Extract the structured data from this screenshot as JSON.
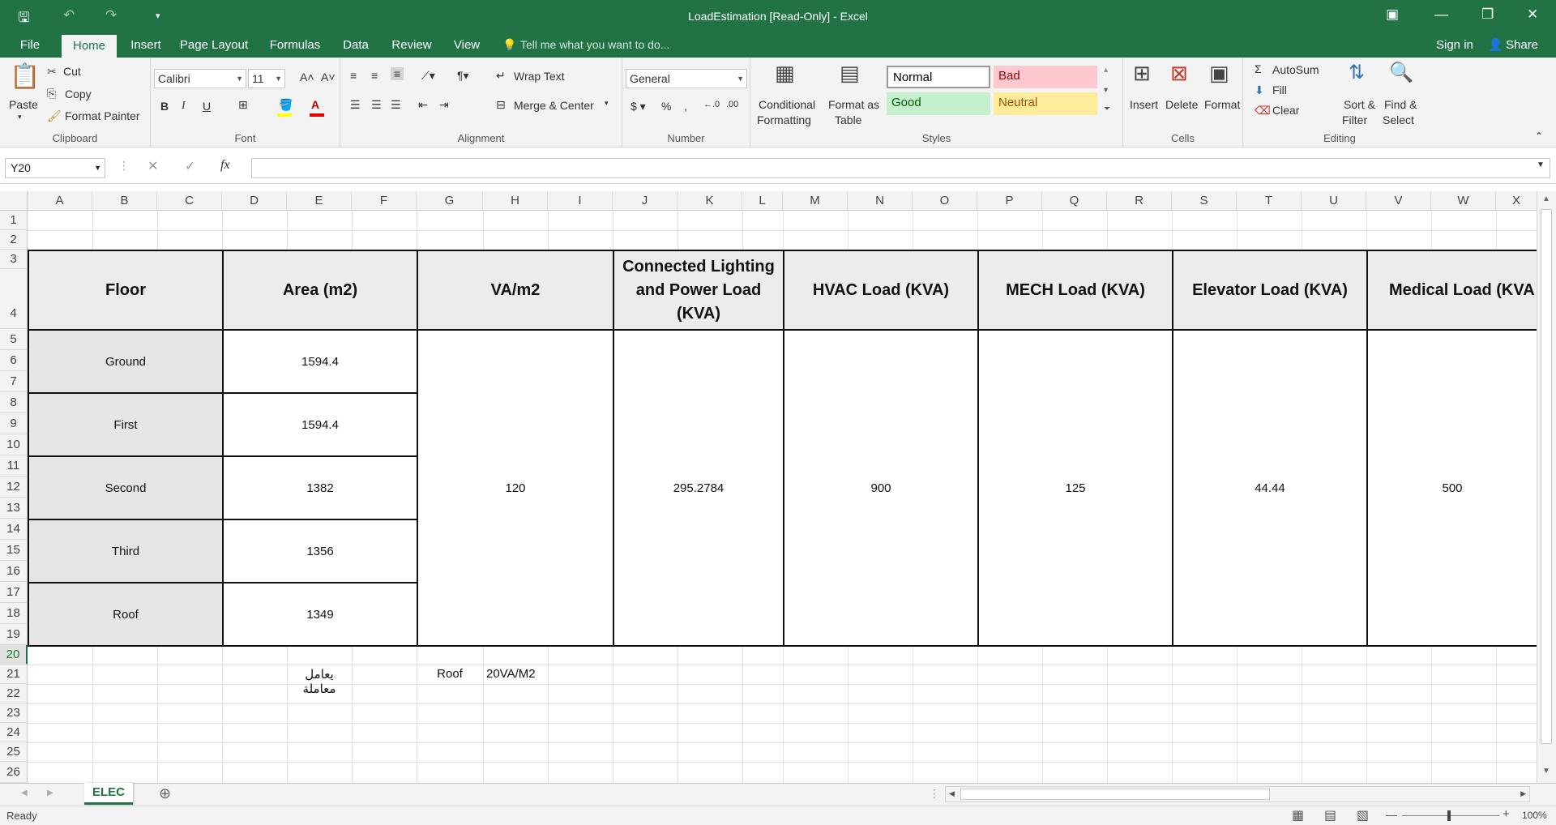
{
  "window": {
    "title": "LoadEstimation  [Read-Only]  -  Excel"
  },
  "ribbon_tabs": [
    "File",
    "Home",
    "Insert",
    "Page Layout",
    "Formulas",
    "Data",
    "Review",
    "View"
  ],
  "tell_me": "Tell me what you want to do...",
  "account": {
    "sign_in": "Sign in",
    "share": "Share"
  },
  "clipboard": {
    "paste": "Paste",
    "cut": "Cut",
    "copy": "Copy",
    "format_painter": "Format Painter",
    "label": "Clipboard"
  },
  "font": {
    "name": "Calibri",
    "size": "11",
    "label": "Font"
  },
  "alignment": {
    "wrap_text": "Wrap Text",
    "merge_center": "Merge & Center",
    "label": "Alignment"
  },
  "number": {
    "format": "General",
    "label": "Number"
  },
  "styles": {
    "conditional": [
      "Conditional",
      "Formatting"
    ],
    "format_table": [
      "Format as",
      "Table"
    ],
    "normal": "Normal",
    "bad": "Bad",
    "good": "Good",
    "neutral": "Neutral",
    "label": "Styles"
  },
  "cells": {
    "insert": "Insert",
    "delete": "Delete",
    "format": "Format",
    "label": "Cells"
  },
  "editing": {
    "autosum": "AutoSum",
    "fill": "Fill",
    "clear": "Clear",
    "sort": [
      "Sort &",
      "Filter"
    ],
    "find": [
      "Find &",
      "Select"
    ],
    "label": "Editing"
  },
  "formula_bar": {
    "name_box": "Y20",
    "formula": ""
  },
  "columns": [
    "A",
    "B",
    "C",
    "D",
    "E",
    "F",
    "G",
    "H",
    "I",
    "J",
    "K",
    "L",
    "M",
    "N",
    "O",
    "P",
    "Q",
    "R",
    "S",
    "T",
    "U",
    "V",
    "W",
    "X"
  ],
  "rows": [
    "1",
    "2",
    "3",
    "4",
    "5",
    "6",
    "7",
    "8",
    "9",
    "10",
    "11",
    "12",
    "13",
    "14",
    "15",
    "16",
    "17",
    "18",
    "19",
    "20",
    "21",
    "22",
    "23",
    "24",
    "25",
    "26"
  ],
  "table": {
    "headers": [
      "Floor",
      "Area (m2)",
      "VA/m2",
      "Connected Lighting and Power Load (KVA)",
      "HVAC Load (KVA)",
      "MECH Load (KVA)",
      "Elevator Load (KVA)",
      "Medical Load (KVA"
    ],
    "floors": [
      "Ground",
      "First",
      "Second",
      "Third",
      "Roof"
    ],
    "areas": [
      "1594.4",
      "1594.4",
      "1382",
      "1356",
      "1349"
    ],
    "va_m2": "120",
    "connected_load": "295.2784",
    "hvac": "900",
    "mech": "125",
    "elevator": "44.44",
    "medical": "500"
  },
  "notes": {
    "factor_label": "يعامل معاملة",
    "roof": "Roof",
    "roof_value": "20VA/M2"
  },
  "sheet_tab": "ELEC",
  "status": {
    "ready": "Ready",
    "zoom": "100%"
  },
  "colors": {
    "accent": "#217346"
  }
}
